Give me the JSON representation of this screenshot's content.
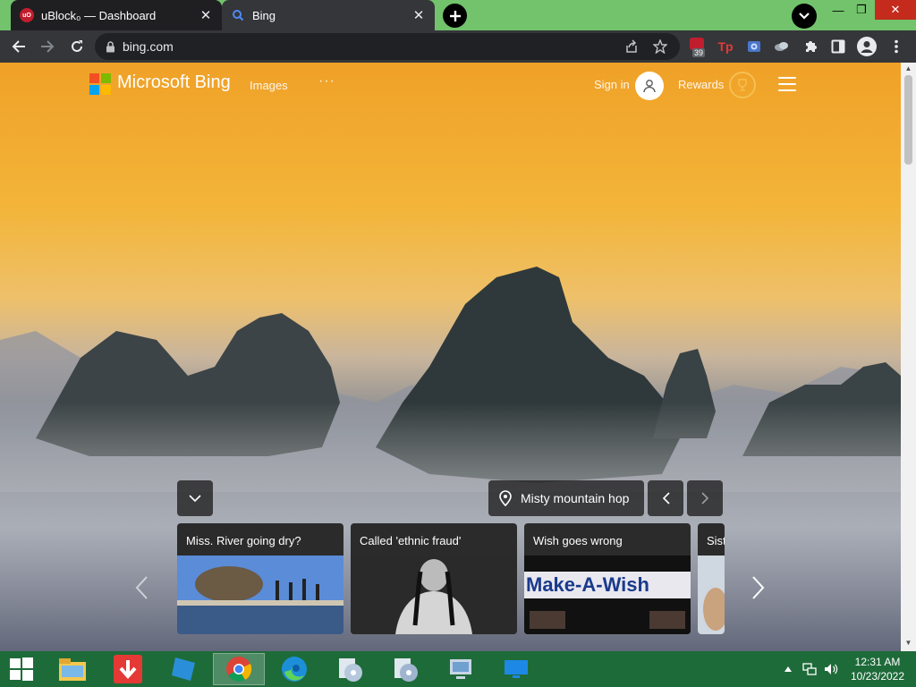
{
  "browser": {
    "tabs": [
      {
        "title": "uBlock₀ — Dashboard",
        "favicon": "ublock-icon",
        "active": true
      },
      {
        "title": "Bing",
        "favicon": "bing-search-icon",
        "active": false
      }
    ],
    "tab_close_glyph": "✕",
    "address": {
      "url": "bing.com"
    },
    "extension_badge": "39",
    "window_controls": {
      "minimize": "—",
      "maximize": "❐",
      "close": "✕"
    }
  },
  "bing": {
    "brand": "Microsoft Bing",
    "nav": {
      "images": "Images",
      "more": "···"
    },
    "sign_in": "Sign in",
    "rewards": "Rewards",
    "image_caption": "Misty mountain hop",
    "news_cards": [
      {
        "title": "Miss. River going dry?"
      },
      {
        "title": "Called 'ethnic fraud'"
      },
      {
        "title": "Wish goes wrong",
        "image_text": "Make-A-Wish"
      },
      {
        "title": "Sist"
      }
    ]
  },
  "taskbar": {
    "apps": [
      "start-icon",
      "file-explorer-icon",
      "downloader-icon",
      "roblox-icon",
      "chrome-icon",
      "edge-icon",
      "disc-app-icon",
      "disc-app-2-icon",
      "network-app-icon",
      "monitor-icon"
    ],
    "clock": {
      "time": "12:31 AM",
      "date": "10/23/2022"
    }
  },
  "colors": {
    "tabstrip": "#72c36b",
    "ms_red": "#f25022",
    "ms_green": "#7fba00",
    "ms_blue": "#00a4ef",
    "ms_yellow": "#ffb900",
    "taskbar": "#1e6b3a"
  }
}
